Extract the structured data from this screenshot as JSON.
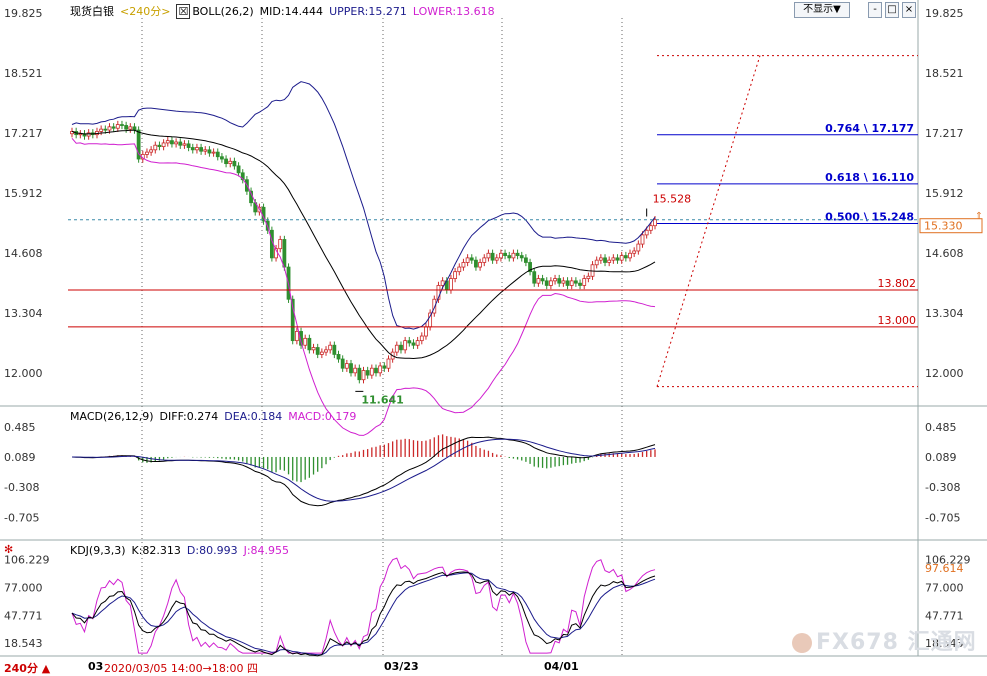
{
  "header": {
    "symbol": "现货白银",
    "period": "<240分>",
    "boll": "BOLL(26,2)",
    "mid": "MID:14.444",
    "upper": "UPPER:15.271",
    "lower": "LOWER:13.618",
    "hide_button": "不显示▼",
    "win_buttons": [
      "-",
      "□",
      "×"
    ]
  },
  "macd_header": {
    "name": "MACD(26,12,9)",
    "diff": "DIFF:0.274",
    "dea": "DEA:0.184",
    "macd": "MACD:0.179"
  },
  "kdj_header": {
    "name": "KDJ(9,3,3)",
    "k": "K:82.313",
    "d": "D:80.993",
    "j": "J:84.955"
  },
  "footer": {
    "period_label": "240分 ▲",
    "date_label": "03",
    "cursor_info": "2020/03/05 14:00→18:00 四",
    "xticks": [
      "03/23",
      "04/01"
    ]
  },
  "watermark": "FX678 汇通网",
  "colors": {
    "up": "#cc2a2a",
    "down": "#2f8f2f",
    "boll_band": "#1c1c8c",
    "boll_mid": "#000000",
    "boll_lower": "#d020d0",
    "fib": "#0000cc",
    "support": "#cc0000"
  },
  "chart_data": [
    {
      "type": "candlestick",
      "title": "现货白银 <240分>",
      "ylim": [
        11.3,
        20.0
      ],
      "yticks": [
        "19.825",
        "18.521",
        "17.217",
        "15.912",
        "14.608",
        "13.304",
        "12.000"
      ],
      "closes": [
        17.25,
        17.18,
        17.2,
        17.15,
        17.22,
        17.18,
        17.25,
        17.3,
        17.28,
        17.35,
        17.32,
        17.4,
        17.38,
        17.3,
        17.35,
        17.28,
        16.65,
        16.75,
        16.8,
        16.85,
        16.95,
        16.92,
        17.0,
        17.05,
        16.98,
        17.02,
        16.95,
        16.98,
        16.9,
        16.85,
        16.9,
        16.82,
        16.85,
        16.78,
        16.8,
        16.7,
        16.65,
        16.55,
        16.6,
        16.5,
        16.35,
        16.2,
        15.95,
        15.7,
        15.5,
        15.6,
        15.3,
        15.1,
        14.5,
        14.7,
        14.9,
        14.3,
        13.6,
        12.7,
        12.9,
        12.6,
        12.75,
        12.5,
        12.55,
        12.4,
        12.45,
        12.5,
        12.6,
        12.4,
        12.3,
        12.1,
        12.2,
        12.0,
        12.1,
        11.85,
        12.05,
        11.95,
        12.1,
        12.0,
        12.15,
        12.1,
        12.3,
        12.45,
        12.6,
        12.5,
        12.7,
        12.65,
        12.6,
        12.7,
        12.8,
        13.0,
        13.3,
        13.6,
        13.9,
        14.0,
        13.8,
        14.05,
        14.2,
        14.3,
        14.4,
        14.5,
        14.45,
        14.3,
        14.4,
        14.5,
        14.6,
        14.45,
        14.5,
        14.6,
        14.55,
        14.5,
        14.6,
        14.55,
        14.5,
        14.4,
        14.2,
        13.95,
        14.05,
        14.0,
        13.9,
        14.0,
        14.05,
        13.95,
        14.0,
        13.9,
        14.0,
        13.95,
        13.9,
        14.05,
        14.1,
        14.35,
        14.45,
        14.5,
        14.4,
        14.45,
        14.5,
        14.45,
        14.55,
        14.5,
        14.6,
        14.65,
        14.8,
        15.0,
        15.1,
        15.2,
        15.33
      ],
      "highlight_high": "15.528",
      "highlight_low": "11.641",
      "boll": {
        "mid_last": 14.444,
        "upper_last": 15.271,
        "lower_last": 13.618
      },
      "fibonacci": [
        {
          "ratio": "0.764",
          "value": 17.177,
          "label": "0.764 \\ 17.177"
        },
        {
          "ratio": "0.618",
          "value": 16.11,
          "label": "0.618 \\ 16.110"
        },
        {
          "ratio": "0.500",
          "value": 15.248,
          "label": "0.500 \\ 15.248"
        }
      ],
      "support_lines": [
        {
          "value": 13.802,
          "label": "13.802"
        },
        {
          "value": 13.0,
          "label": "13.000"
        }
      ],
      "projection_box": {
        "top": 18.9,
        "bottom": 11.7
      },
      "current_price": "15.330",
      "current_price_value": 15.33,
      "current_line": 15.33
    },
    {
      "type": "macd",
      "title": "MACD(26,12,9)",
      "ylim": [
        -1.0,
        0.6
      ],
      "yticks": [
        "0.485",
        "0.089",
        "-0.308",
        "-0.705"
      ],
      "diff_last": 0.274,
      "dea_last": 0.184,
      "macd_last": 0.179
    },
    {
      "type": "kdj",
      "title": "KDJ(9,3,3)",
      "ylim": [
        5,
        110
      ],
      "yticks": [
        "106.229",
        "77.000",
        "47.771",
        "18.543"
      ],
      "k_last": 82.313,
      "d_last": 80.993,
      "j_last": 84.955,
      "current": "97.614"
    }
  ]
}
